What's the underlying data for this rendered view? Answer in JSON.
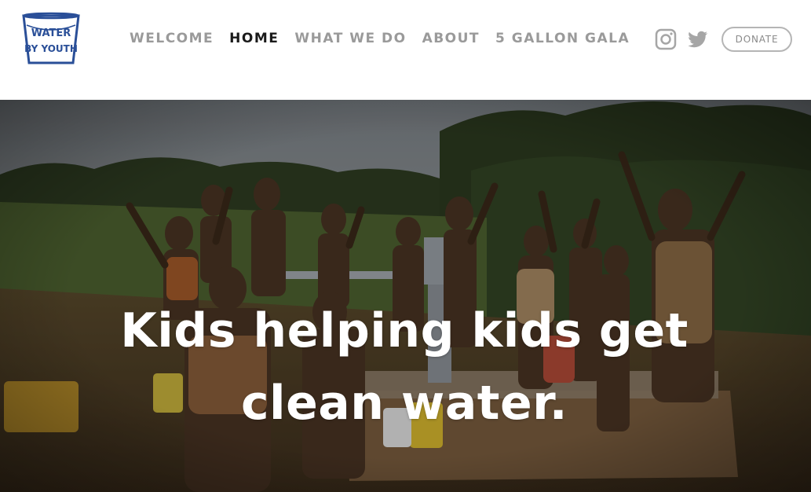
{
  "logo": {
    "line1": "WATER",
    "line2": "BY YOUTH",
    "icon": "bucket-logo-icon",
    "color": "#2a4f98"
  },
  "nav": {
    "items": [
      {
        "label": "WELCOME",
        "active": false
      },
      {
        "label": "HOME",
        "active": true
      },
      {
        "label": "WHAT WE DO",
        "active": false
      },
      {
        "label": "ABOUT",
        "active": false
      },
      {
        "label": "5 GALLON GALA",
        "active": false
      }
    ]
  },
  "social": {
    "instagram_icon": "instagram-icon",
    "twitter_icon": "twitter-icon"
  },
  "donate_label": "DONATE",
  "hero": {
    "title": "Kids helping kids get clean water.",
    "image_description_icon": "hero-photo"
  },
  "colors": {
    "nav_text": "#9a9a9a",
    "nav_active": "#1a1a1a",
    "button_border": "#b5b5b5",
    "hero_text": "#ffffff"
  }
}
